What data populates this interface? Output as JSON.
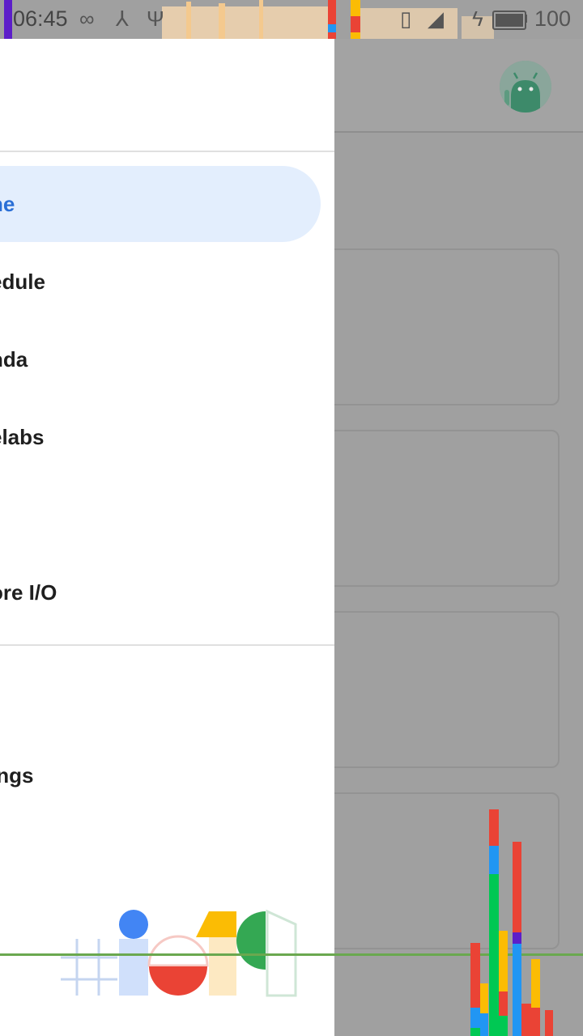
{
  "status_bar": {
    "time": "06:45",
    "battery_percent": "100",
    "icons": [
      "infinity-icon",
      "share-hub-icon",
      "usb-icon",
      "vibrate-icon",
      "signal-icon",
      "charging-icon",
      "battery-icon"
    ]
  },
  "drawer": {
    "items": [
      {
        "label": "ne",
        "active": true
      },
      {
        "label": "edule",
        "active": false
      },
      {
        "label": "nda",
        "active": false
      },
      {
        "label": "elabs",
        "active": false
      },
      {
        "label": "ore I/O",
        "active": false
      },
      {
        "label": "ings",
        "active": false
      }
    ]
  },
  "colors": {
    "active_bg": "#e3eefd",
    "active_text": "#2a6fd6",
    "logo_blue": "#4285f4",
    "logo_red": "#ea4335",
    "logo_yellow": "#fbbc04",
    "logo_green": "#34a853"
  }
}
